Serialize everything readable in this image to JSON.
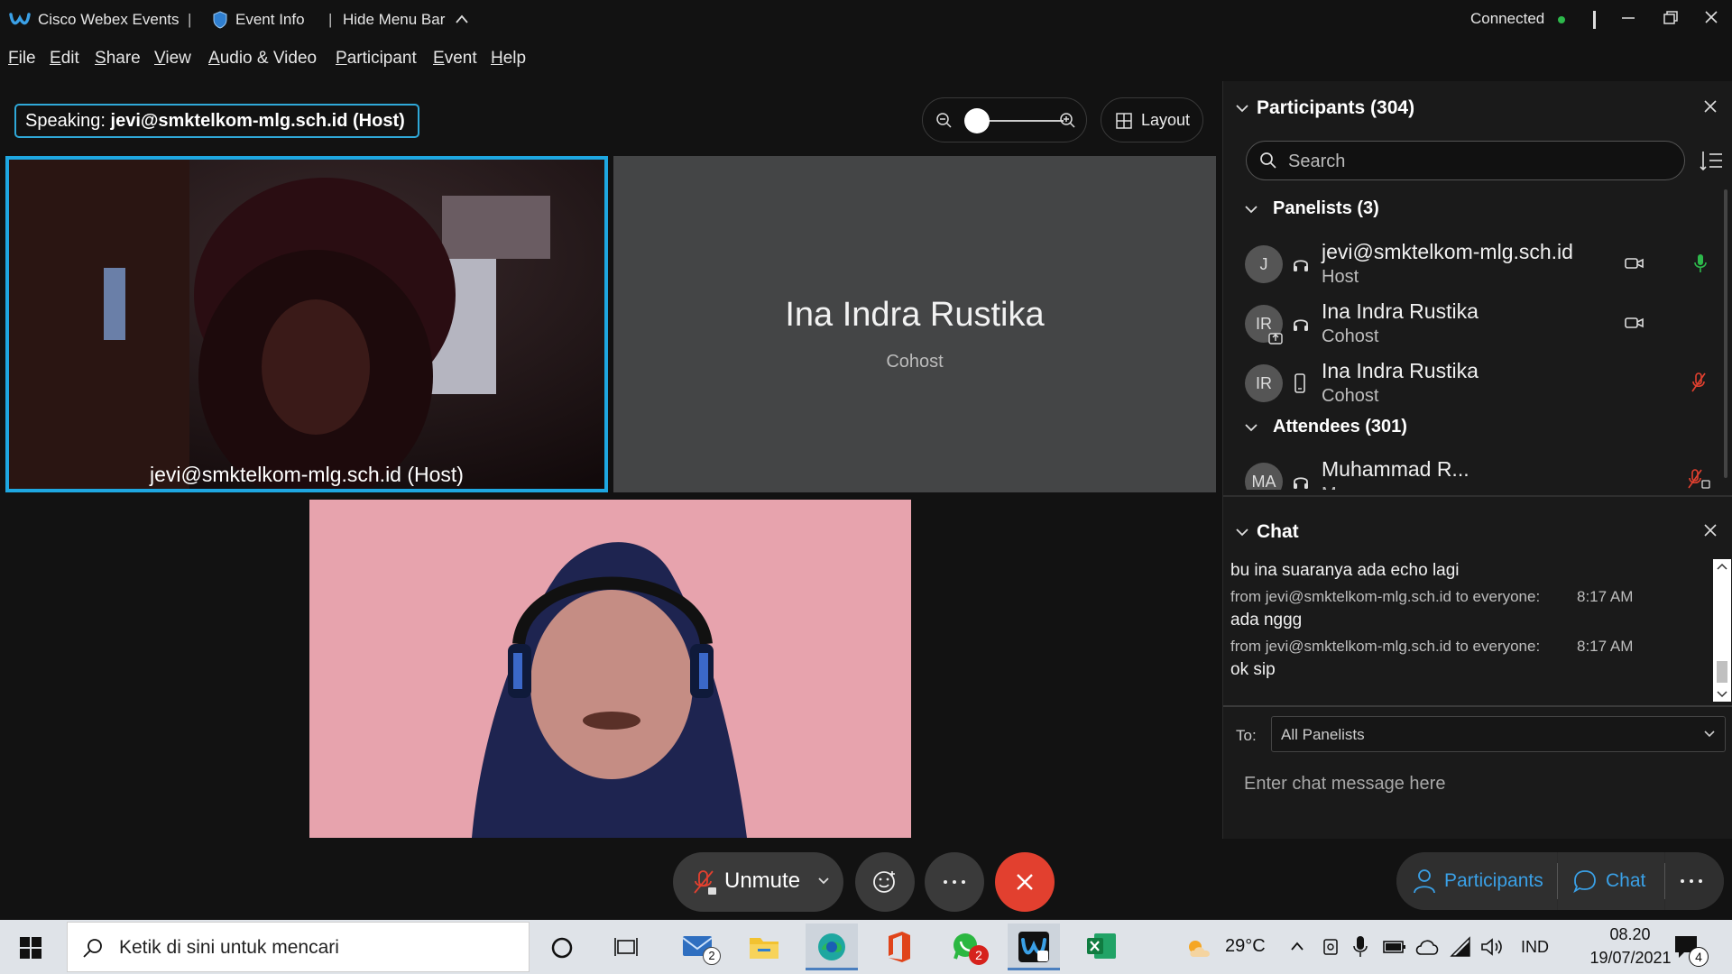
{
  "titlebar": {
    "app_name": "Cisco Webex Events",
    "event_info": "Event Info",
    "hide_menu": "Hide Menu Bar",
    "status": "Connected"
  },
  "menu": [
    "File",
    "Edit",
    "Share",
    "View",
    "Audio & Video",
    "Participant",
    "Event",
    "Help"
  ],
  "speaking": {
    "label": "Speaking:",
    "name": "jevi@smktelkom-mlg.sch.id (Host)"
  },
  "stage": {
    "layout_label": "Layout",
    "host_video_caption": "jevi@smktelkom-mlg.sch.id (Host)",
    "cohost_name": "Ina Indra Rustika",
    "cohost_role": "Cohost"
  },
  "controls": {
    "unmute_label": "Unmute"
  },
  "participants": {
    "title": "Participants (304)",
    "search_placeholder": "Search",
    "panelists_header": "Panelists (3)",
    "attendees_header": "Attendees (301)",
    "rows": [
      {
        "initials": "J",
        "name": "jevi@smktelkom-mlg.sch.id",
        "role": "Host"
      },
      {
        "initials": "IR",
        "name": "Ina Indra Rustika",
        "role": "Cohost"
      },
      {
        "initials": "IR",
        "name": "Ina Indra Rustika",
        "role": "Cohost"
      }
    ],
    "attendee": {
      "initials": "MA",
      "name": "Muhammad R...",
      "role": "Mo"
    }
  },
  "chat": {
    "title": "Chat",
    "messages": [
      {
        "text": "bu ina suaranya ada echo lagi",
        "meta": "from jevi@smktelkom-mlg.sch.id to everyone:",
        "time": "8:17 AM"
      },
      {
        "text": "ada nggg",
        "meta": "from jevi@smktelkom-mlg.sch.id to everyone:",
        "time": "8:17 AM"
      },
      {
        "text": "ok sip"
      }
    ],
    "to_label": "To:",
    "to_value": "All Panelists",
    "input_placeholder": "Enter chat message here"
  },
  "bottom_tabs": {
    "participants_label": "Participants",
    "chat_label": "Chat"
  },
  "taskbar": {
    "search_placeholder": "Ketik di sini untuk mencari",
    "mail_badge": "2",
    "whatsapp_badge": "2",
    "weather": "29°C",
    "language": "IND",
    "time": "08.20",
    "date": "19/07/2021",
    "notif_count": "4"
  },
  "colors": {
    "accent": "#1ea7e1",
    "end_call": "#e2402f",
    "connected": "#2db84b",
    "mic_on": "#2db84b",
    "mic_muted": "#e2402f",
    "bottom_tab_text": "#3aa0e6"
  }
}
